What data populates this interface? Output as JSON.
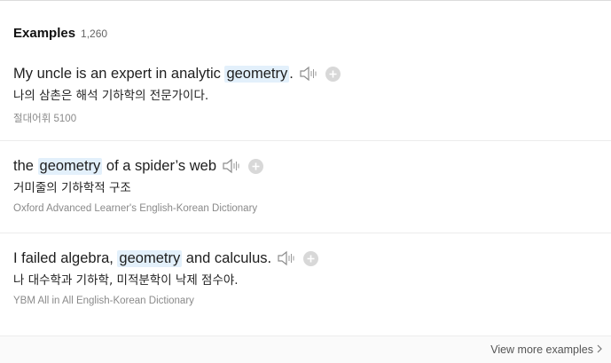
{
  "header": {
    "title": "Examples",
    "count": "1,260"
  },
  "examples": [
    {
      "before": "My uncle is an expert in analytic ",
      "highlight": "geometry",
      "after": ".",
      "ko": "나의 삼촌은 해석 기하학의 전문가이다.",
      "source": "절대어휘 5100"
    },
    {
      "before": "the ",
      "highlight": "geometry",
      "after": " of a spider’s web",
      "ko": "거미줄의 기하학적 구조",
      "source": "Oxford Advanced Learner's English-Korean Dictionary"
    },
    {
      "before": "I failed algebra, ",
      "highlight": "geometry",
      "after": " and calculus.",
      "ko": "나 대수학과 기하학, 미적분학이 낙제 점수야.",
      "source": "YBM All in All English-Korean Dictionary"
    }
  ],
  "footer": {
    "more_label": "View more examples"
  },
  "icons": {
    "speaker": "speaker-icon",
    "add": "plus-icon",
    "chevron": "chevron-right-icon"
  },
  "colors": {
    "highlight": "#e3f0fb"
  }
}
